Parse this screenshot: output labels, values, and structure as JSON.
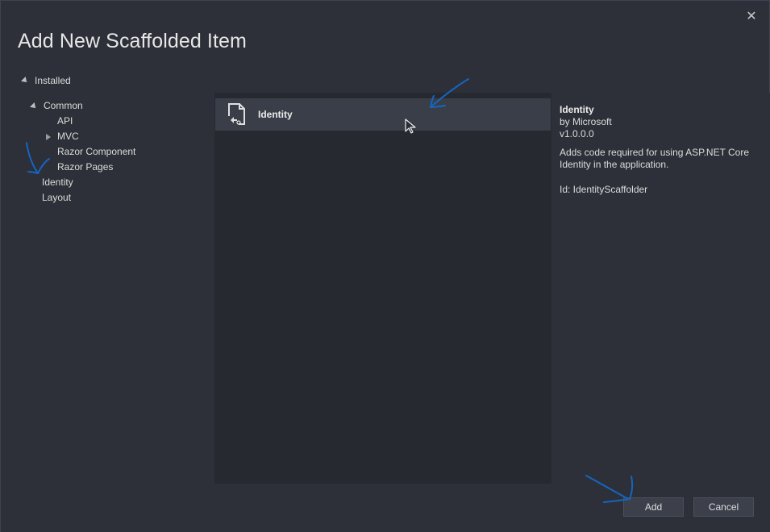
{
  "dialog": {
    "title": "Add New Scaffolded Item",
    "close_label": "✕"
  },
  "tree": {
    "root_label": "Installed",
    "items": [
      {
        "label": "Common"
      },
      {
        "label": "API"
      },
      {
        "label": "MVC"
      },
      {
        "label": "Razor Component"
      },
      {
        "label": "Razor Pages"
      },
      {
        "label": "Identity"
      },
      {
        "label": "Layout"
      }
    ]
  },
  "list": {
    "items": [
      {
        "label": "Identity",
        "icon": "scaffolder-document-icon"
      }
    ]
  },
  "details": {
    "title": "Identity",
    "author": "by Microsoft",
    "version": "v1.0.0.0",
    "description": "Adds code required for using ASP.NET Core Identity in the application.",
    "id_line": "Id: IdentityScaffolder"
  },
  "footer": {
    "add_label": "Add",
    "cancel_label": "Cancel"
  },
  "colors": {
    "background": "#2d3038",
    "list_background": "#262930",
    "selected_row": "#3a3e48",
    "annotation_blue": "#1565c0"
  }
}
